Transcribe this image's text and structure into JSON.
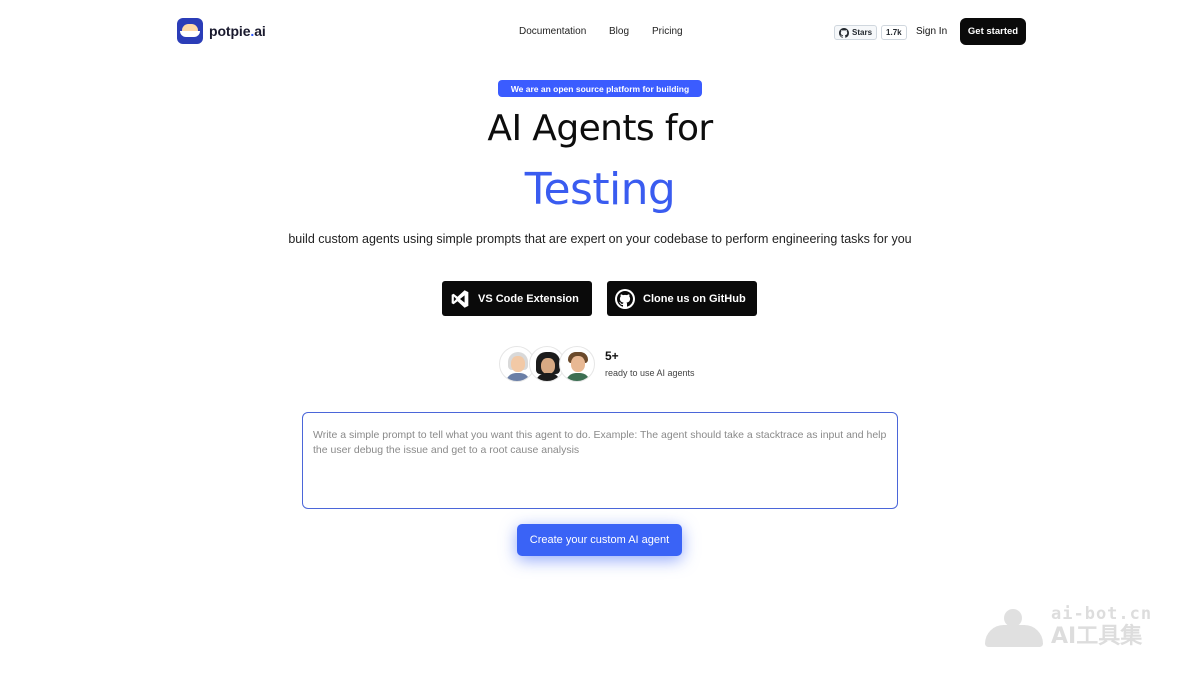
{
  "header": {
    "logo_text_prefix": "potpie",
    "logo_text_dot": ".",
    "logo_text_suffix": "ai",
    "nav": [
      {
        "label": "Documentation"
      },
      {
        "label": "Blog"
      },
      {
        "label": "Pricing"
      }
    ],
    "github_stars_label": "Stars",
    "github_stars_count": "1.7k",
    "sign_in_label": "Sign In",
    "get_started_label": "Get started"
  },
  "hero": {
    "pill_text": "We are an open source platform for building",
    "headline": "AI Agents for",
    "headline_accent": "Testing",
    "subhead": "build custom agents using simple prompts that are expert on your codebase to perform engineering tasks for you",
    "vscode_button_label": "VS Code Extension",
    "github_button_label": "Clone us on GitHub",
    "agents_count": "5+",
    "agents_caption": "ready to use AI agents"
  },
  "prompt": {
    "placeholder": "Write a simple prompt to tell what you want this agent to do. Example: The agent should take a stacktrace as input and help the user debug the issue and get to a root cause analysis",
    "value": ""
  },
  "create_button_label": "Create your custom AI agent",
  "watermark": {
    "line1": "ai-bot.cn",
    "line2": "AI工具集"
  },
  "colors": {
    "accent": "#3a5cf0",
    "pill": "#3b5cff",
    "dark_button": "#0a0a0a"
  },
  "icons": {
    "logo": "potpie-logo-icon",
    "github": "github-icon",
    "vscode": "vscode-icon"
  }
}
